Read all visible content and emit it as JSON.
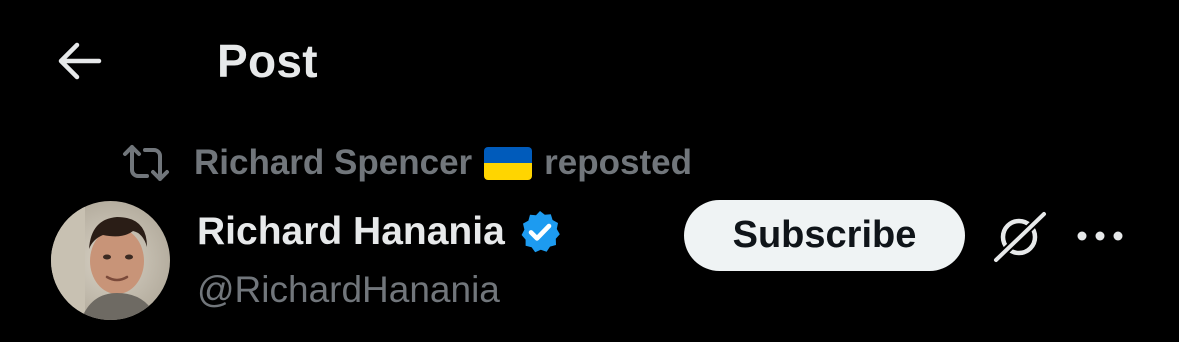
{
  "header": {
    "back_icon": "arrow-left-icon",
    "title": "Post"
  },
  "repost": {
    "icon": "repost-icon",
    "user": "Richard Spencer",
    "flag_icon": "ukraine-flag-icon",
    "suffix": "reposted"
  },
  "author": {
    "display_name": "Richard Hanania",
    "verified_icon": "verified-badge-icon",
    "handle": "@RichardHanania",
    "avatar_icon": "avatar-photo"
  },
  "actions": {
    "subscribe_label": "Subscribe",
    "grok_icon": "grok-icon",
    "more_icon": "more-horizontal-icon"
  },
  "colors": {
    "background": "#000000",
    "primary_text": "#e7e9ea",
    "secondary_text": "#71767b",
    "verified_blue": "#1d9bf0",
    "button_bg": "#eff3f4",
    "button_text": "#0f1419",
    "flag_blue": "#005bbb",
    "flag_yellow": "#ffd500"
  }
}
